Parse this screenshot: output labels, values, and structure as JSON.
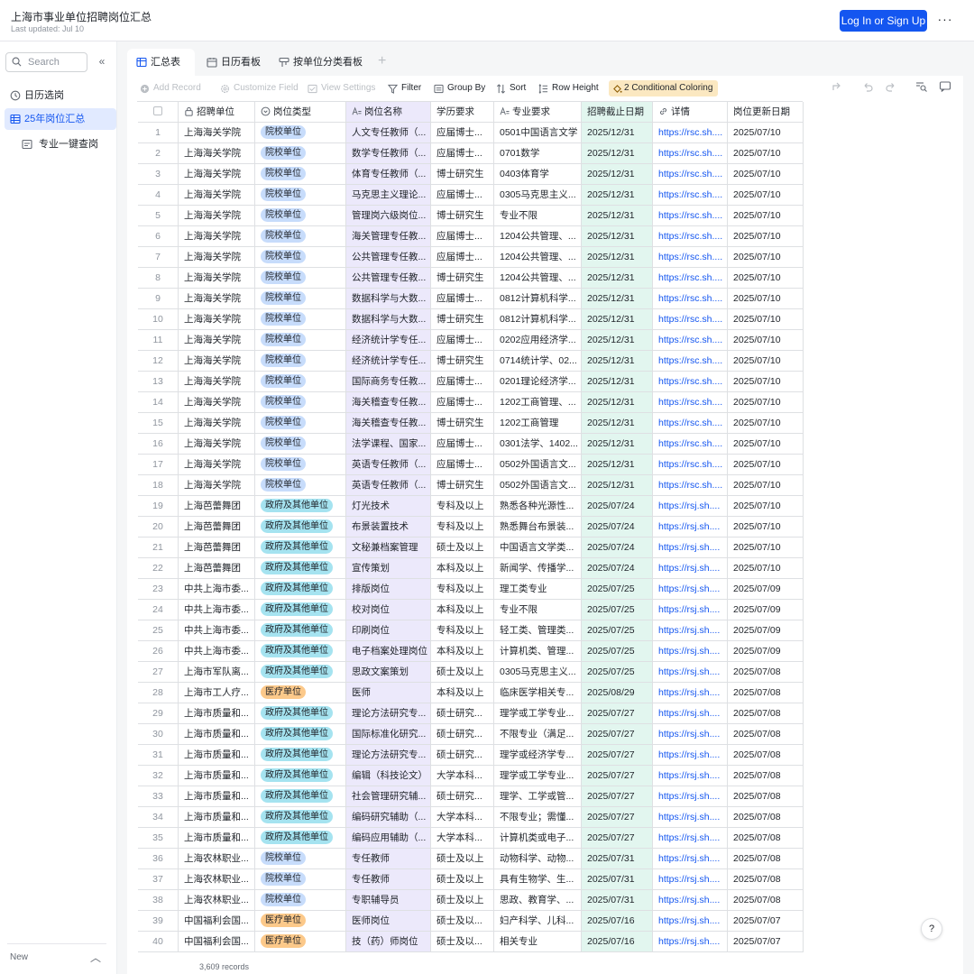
{
  "header": {
    "title": "上海市事业单位招聘岗位汇总",
    "subtitle": "Last updated: Jul 10",
    "login_label": "Log In or Sign Up",
    "more_label": "···"
  },
  "sidebar": {
    "search_placeholder": "Search",
    "collapse_label": "«",
    "items": [
      {
        "label": "日历选岗",
        "icon": "clock-icon",
        "active": false
      },
      {
        "label": "25年岗位汇总",
        "icon": "grid-table-icon",
        "active": true
      },
      {
        "label": "专业一键查岗",
        "icon": "form-icon",
        "active": false
      }
    ],
    "new_label": "New"
  },
  "tabs": [
    {
      "label": "汇总表",
      "icon": "grid-table-icon"
    },
    {
      "label": "日历看板",
      "icon": "calendar-icon"
    },
    {
      "label": "按单位分类看板",
      "icon": "kanban-icon"
    }
  ],
  "toolbar": {
    "add_record": "Add Record",
    "customize_field": "Customize Field",
    "view_settings": "View Settings",
    "filter": "Filter",
    "group_by": "Group By",
    "sort": "Sort",
    "row_height": "Row Height",
    "conditional": "2 Conditional Coloring"
  },
  "table": {
    "columns": [
      "招聘单位",
      "岗位类型",
      "岗位名称",
      "学历要求",
      "专业要求",
      "招聘截止日期",
      "详情",
      "岗位更新日期"
    ],
    "tag_colors": {
      "院校单位": {
        "bg": "#c7dcfb",
        "fg": "#1f2329"
      },
      "政府及其他单位": {
        "bg": "#a5e3f0",
        "fg": "#1f2329"
      },
      "医疗单位": {
        "bg": "#fcc98a",
        "fg": "#1f2329"
      }
    },
    "rows": [
      [
        "1",
        "上海海关学院",
        "院校单位",
        "人文专任教师（...",
        "应届博士...",
        "0501中国语言文学",
        "2025/12/31",
        "https://rsc.sh....",
        "2025/07/10"
      ],
      [
        "2",
        "上海海关学院",
        "院校单位",
        "数学专任教师（...",
        "应届博士...",
        "0701数学",
        "2025/12/31",
        "https://rsc.sh....",
        "2025/07/10"
      ],
      [
        "3",
        "上海海关学院",
        "院校单位",
        "体育专任教师（...",
        "博士研究生",
        "0403体育学",
        "2025/12/31",
        "https://rsc.sh....",
        "2025/07/10"
      ],
      [
        "4",
        "上海海关学院",
        "院校单位",
        "马克思主义理论...",
        "应届博士...",
        "0305马克思主义...",
        "2025/12/31",
        "https://rsc.sh....",
        "2025/07/10"
      ],
      [
        "5",
        "上海海关学院",
        "院校单位",
        "管理岗六级岗位...",
        "博士研究生",
        "专业不限",
        "2025/12/31",
        "https://rsc.sh....",
        "2025/07/10"
      ],
      [
        "6",
        "上海海关学院",
        "院校单位",
        "海关管理专任教...",
        "应届博士...",
        "1204公共管理、...",
        "2025/12/31",
        "https://rsc.sh....",
        "2025/07/10"
      ],
      [
        "7",
        "上海海关学院",
        "院校单位",
        "公共管理专任教...",
        "应届博士...",
        "1204公共管理、...",
        "2025/12/31",
        "https://rsc.sh....",
        "2025/07/10"
      ],
      [
        "8",
        "上海海关学院",
        "院校单位",
        "公共管理专任教...",
        "博士研究生",
        "1204公共管理、...",
        "2025/12/31",
        "https://rsc.sh....",
        "2025/07/10"
      ],
      [
        "9",
        "上海海关学院",
        "院校单位",
        "数据科学与大数...",
        "应届博士...",
        "0812计算机科学...",
        "2025/12/31",
        "https://rsc.sh....",
        "2025/07/10"
      ],
      [
        "10",
        "上海海关学院",
        "院校单位",
        "数据科学与大数...",
        "博士研究生",
        "0812计算机科学...",
        "2025/12/31",
        "https://rsc.sh....",
        "2025/07/10"
      ],
      [
        "11",
        "上海海关学院",
        "院校单位",
        "经济统计学专任...",
        "应届博士...",
        "0202应用经济学...",
        "2025/12/31",
        "https://rsc.sh....",
        "2025/07/10"
      ],
      [
        "12",
        "上海海关学院",
        "院校单位",
        "经济统计学专任...",
        "博士研究生",
        "0714统计学、02...",
        "2025/12/31",
        "https://rsc.sh....",
        "2025/07/10"
      ],
      [
        "13",
        "上海海关学院",
        "院校单位",
        "国际商务专任教...",
        "应届博士...",
        "0201理论经济学...",
        "2025/12/31",
        "https://rsc.sh....",
        "2025/07/10"
      ],
      [
        "14",
        "上海海关学院",
        "院校单位",
        "海关稽查专任教...",
        "应届博士...",
        "1202工商管理、...",
        "2025/12/31",
        "https://rsc.sh....",
        "2025/07/10"
      ],
      [
        "15",
        "上海海关学院",
        "院校单位",
        "海关稽查专任教...",
        "博士研究生",
        "1202工商管理",
        "2025/12/31",
        "https://rsc.sh....",
        "2025/07/10"
      ],
      [
        "16",
        "上海海关学院",
        "院校单位",
        "法学课程、国家...",
        "应届博士...",
        "0301法学、1402...",
        "2025/12/31",
        "https://rsc.sh....",
        "2025/07/10"
      ],
      [
        "17",
        "上海海关学院",
        "院校单位",
        "英语专任教师（...",
        "应届博士...",
        "0502外国语言文...",
        "2025/12/31",
        "https://rsc.sh....",
        "2025/07/10"
      ],
      [
        "18",
        "上海海关学院",
        "院校单位",
        "英语专任教师（...",
        "博士研究生",
        "0502外国语言文...",
        "2025/12/31",
        "https://rsc.sh....",
        "2025/07/10"
      ],
      [
        "19",
        "上海芭蕾舞团",
        "政府及其他单位",
        "灯光技术",
        "专科及以上",
        "熟悉各种光源性...",
        "2025/07/24",
        "https://rsj.sh....",
        "2025/07/10"
      ],
      [
        "20",
        "上海芭蕾舞团",
        "政府及其他单位",
        "布景装置技术",
        "专科及以上",
        "熟悉舞台布景装...",
        "2025/07/24",
        "https://rsj.sh....",
        "2025/07/10"
      ],
      [
        "21",
        "上海芭蕾舞团",
        "政府及其他单位",
        "文秘兼档案管理",
        "硕士及以上",
        "中国语言文学类...",
        "2025/07/24",
        "https://rsj.sh....",
        "2025/07/10"
      ],
      [
        "22",
        "上海芭蕾舞团",
        "政府及其他单位",
        "宣传策划",
        "本科及以上",
        "新闻学、传播学...",
        "2025/07/24",
        "https://rsj.sh....",
        "2025/07/10"
      ],
      [
        "23",
        "中共上海市委...",
        "政府及其他单位",
        "排版岗位",
        "专科及以上",
        "理工类专业",
        "2025/07/25",
        "https://rsj.sh....",
        "2025/07/09"
      ],
      [
        "24",
        "中共上海市委...",
        "政府及其他单位",
        "校对岗位",
        "本科及以上",
        "专业不限",
        "2025/07/25",
        "https://rsj.sh....",
        "2025/07/09"
      ],
      [
        "25",
        "中共上海市委...",
        "政府及其他单位",
        "印刷岗位",
        "专科及以上",
        "轻工类、管理类...",
        "2025/07/25",
        "https://rsj.sh....",
        "2025/07/09"
      ],
      [
        "26",
        "中共上海市委...",
        "政府及其他单位",
        "电子档案处理岗位",
        "本科及以上",
        "计算机类、管理...",
        "2025/07/25",
        "https://rsj.sh....",
        "2025/07/09"
      ],
      [
        "27",
        "上海市军队离...",
        "政府及其他单位",
        "思政文案策划",
        "硕士及以上",
        "0305马克思主义...",
        "2025/07/25",
        "https://rsj.sh....",
        "2025/07/08"
      ],
      [
        "28",
        "上海市工人疗...",
        "医疗单位",
        "医师",
        "本科及以上",
        "临床医学相关专...",
        "2025/08/29",
        "https://rsj.sh....",
        "2025/07/08"
      ],
      [
        "29",
        "上海市质量和...",
        "政府及其他单位",
        "理论方法研究专...",
        "硕士研究...",
        "理学或工学专业...",
        "2025/07/27",
        "https://rsj.sh....",
        "2025/07/08"
      ],
      [
        "30",
        "上海市质量和...",
        "政府及其他单位",
        "国际标准化研究...",
        "硕士研究...",
        "不限专业（满足...",
        "2025/07/27",
        "https://rsj.sh....",
        "2025/07/08"
      ],
      [
        "31",
        "上海市质量和...",
        "政府及其他单位",
        "理论方法研究专...",
        "硕士研究...",
        "理学或经济学专...",
        "2025/07/27",
        "https://rsj.sh....",
        "2025/07/08"
      ],
      [
        "32",
        "上海市质量和...",
        "政府及其他单位",
        "编辑（科技论文）",
        "大学本科...",
        "理学或工学专业...",
        "2025/07/27",
        "https://rsj.sh....",
        "2025/07/08"
      ],
      [
        "33",
        "上海市质量和...",
        "政府及其他单位",
        "社会管理研究辅...",
        "硕士研究...",
        "理学、工学或管...",
        "2025/07/27",
        "https://rsj.sh....",
        "2025/07/08"
      ],
      [
        "34",
        "上海市质量和...",
        "政府及其他单位",
        "编码研究辅助（...",
        "大学本科...",
        "不限专业；需懂...",
        "2025/07/27",
        "https://rsj.sh....",
        "2025/07/08"
      ],
      [
        "35",
        "上海市质量和...",
        "政府及其他单位",
        "编码应用辅助（...",
        "大学本科...",
        "计算机类或电子...",
        "2025/07/27",
        "https://rsj.sh....",
        "2025/07/08"
      ],
      [
        "36",
        "上海农林职业...",
        "院校单位",
        "专任教师",
        "硕士及以上",
        "动物科学、动物...",
        "2025/07/31",
        "https://rsj.sh....",
        "2025/07/08"
      ],
      [
        "37",
        "上海农林职业...",
        "院校单位",
        "专任教师",
        "硕士及以上",
        "具有生物学、生...",
        "2025/07/31",
        "https://rsj.sh....",
        "2025/07/08"
      ],
      [
        "38",
        "上海农林职业...",
        "院校单位",
        "专职辅导员",
        "硕士及以上",
        "思政、教育学、...",
        "2025/07/31",
        "https://rsj.sh....",
        "2025/07/08"
      ],
      [
        "39",
        "中国福利会国...",
        "医疗单位",
        "医师岗位",
        "硕士及以...",
        "妇产科学、儿科...",
        "2025/07/16",
        "https://rsj.sh....",
        "2025/07/07"
      ],
      [
        "40",
        "中国福利会国...",
        "医疗单位",
        "技（药）师岗位",
        "硕士及以...",
        "相关专业",
        "2025/07/16",
        "https://rsj.sh....",
        "2025/07/07"
      ]
    ]
  },
  "footer": {
    "record_count": "3,609 records"
  },
  "help_label": "?"
}
